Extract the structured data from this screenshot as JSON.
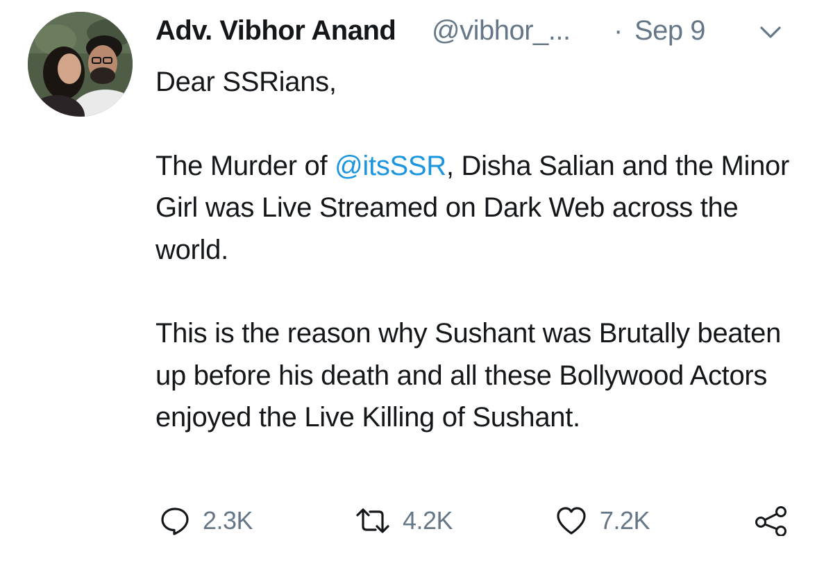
{
  "tweet": {
    "display_name": "Adv. Vibhor Anand",
    "handle": "@vibhor_...",
    "separator": "·",
    "date": "Sep 9",
    "greeting": "Dear SSRians,",
    "para1_before": "The Murder of ",
    "mention": "@itsSSR",
    "para1_after": ", Disha Salian and the Minor Girl was Live Streamed on Dark Web across the world.",
    "para2": "This is the reason why Sushant was Brutally beaten up before his death and all these Bollywood Actors enjoyed the Live Killing of Sushant."
  },
  "actions": {
    "replies": "2.3K",
    "retweets": "4.2K",
    "likes": "7.2K"
  },
  "icons": {
    "reply": "reply-icon",
    "retweet": "retweet-icon",
    "like": "heart-icon",
    "share": "share-icon",
    "caret": "chevron-down-icon"
  },
  "colors": {
    "text": "#14171a",
    "muted": "#657786",
    "link": "#1b95e0"
  }
}
